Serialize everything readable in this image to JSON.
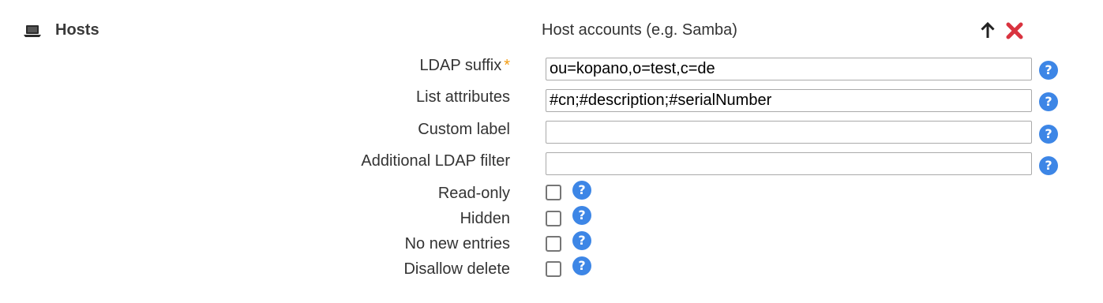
{
  "header": {
    "icon": "laptop-icon",
    "title": "Hosts",
    "description": "Host accounts (e.g. Samba)",
    "move_up_icon": "arrow-up-icon",
    "remove_icon": "red-x-icon",
    "remove_color": "#d9333f"
  },
  "fields": {
    "ldap_suffix": {
      "label": "LDAP suffix",
      "required_marker": "*",
      "value": "ou=kopano,o=test,c=de"
    },
    "list_attributes": {
      "label": "List attributes",
      "value": "#cn;#description;#serialNumber"
    },
    "custom_label": {
      "label": "Custom label",
      "value": ""
    },
    "additional_ldap_filter": {
      "label": "Additional LDAP filter",
      "value": ""
    }
  },
  "checkboxes": {
    "read_only": {
      "label": "Read-only",
      "checked": false
    },
    "hidden": {
      "label": "Hidden",
      "checked": false
    },
    "no_new_entries": {
      "label": "No new entries",
      "checked": false
    },
    "disallow_delete": {
      "label": "Disallow delete",
      "checked": false
    }
  },
  "help": {
    "glyph": "?",
    "color": "#3d86e6"
  }
}
